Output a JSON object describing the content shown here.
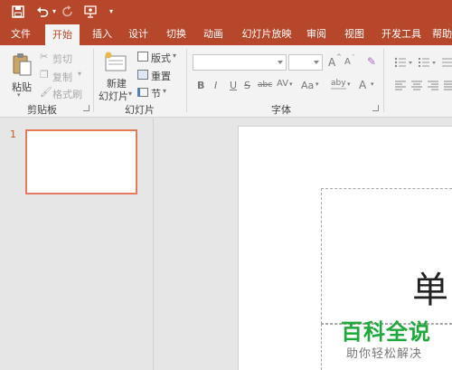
{
  "quick_access": {
    "save_icon": "save-icon",
    "undo_icon": "undo-icon",
    "redo_icon": "redo-icon",
    "start_icon": "present-from-start-icon",
    "customize_icon": "customize-toolbar-icon"
  },
  "tabs": [
    {
      "label": "文件"
    },
    {
      "label": "开始",
      "active": true
    },
    {
      "label": "插入"
    },
    {
      "label": "设计"
    },
    {
      "label": "切换"
    },
    {
      "label": "动画"
    },
    {
      "label": "幻灯片放映"
    },
    {
      "label": "审阅"
    },
    {
      "label": "视图"
    },
    {
      "label": "开发工具"
    },
    {
      "label": "帮助"
    }
  ],
  "clipboard": {
    "paste": "粘贴",
    "cut": "剪切",
    "copy": "复制",
    "format_painter": "格式刷",
    "group": "剪贴板"
  },
  "slides_group": {
    "new_slide_line1": "新建",
    "new_slide_line2": "幻灯片",
    "layout": "版式",
    "reset": "重置",
    "section": "节",
    "group": "幻灯片"
  },
  "font": {
    "group": "字体",
    "name_value": "",
    "size_value": "",
    "grow": "A",
    "shrink": "A",
    "bold": "B",
    "italic": "I",
    "underline": "U",
    "strike": "S",
    "shadow": "abc",
    "spacing": "AV",
    "case": "Aa",
    "highlight": "aby",
    "color": "A"
  },
  "slide_panel": {
    "slide_number": "1"
  },
  "editor": {
    "title_text": "单"
  },
  "watermark": {
    "line1": "百科全说",
    "line2": "助你轻松解决"
  },
  "colors": {
    "accent": "#b7472a",
    "thumb_border": "#e57a5c",
    "watermark_green": "#1fa83b"
  }
}
